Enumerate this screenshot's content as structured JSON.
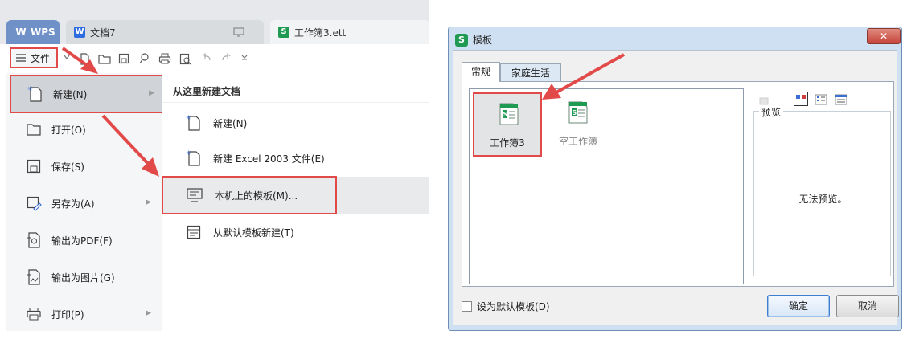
{
  "wps": {
    "tabs": [
      {
        "label": "WPS"
      },
      {
        "label": "文档7"
      },
      {
        "label": "工作簿3.ett"
      }
    ],
    "menu_button_label": "文件",
    "file_menu": [
      {
        "label": "新建(N)",
        "icon": "new-file-icon",
        "has_submenu": true
      },
      {
        "label": "打开(O)",
        "icon": "open-folder-icon",
        "has_submenu": false
      },
      {
        "label": "保存(S)",
        "icon": "save-icon",
        "has_submenu": false
      },
      {
        "label": "另存为(A)",
        "icon": "save-as-icon",
        "has_submenu": true
      },
      {
        "label": "输出为PDF(F)",
        "icon": "export-pdf-icon",
        "has_submenu": false
      },
      {
        "label": "输出为图片(G)",
        "icon": "export-image-icon",
        "has_submenu": false
      },
      {
        "label": "打印(P)",
        "icon": "print-icon",
        "has_submenu": true
      }
    ],
    "submenu": {
      "title": "从这里新建文档",
      "items": [
        {
          "label": "新建(N)",
          "icon": "new-file-icon"
        },
        {
          "label": "新建 Excel 2003 文件(E)",
          "icon": "new-file-icon"
        },
        {
          "label": "本机上的模板(M)...",
          "icon": "local-template-icon"
        },
        {
          "label": "从默认模板新建(T)",
          "icon": "default-template-icon"
        }
      ]
    },
    "highlight_color": "#e24a4a"
  },
  "dialog": {
    "title": "模板",
    "close_label": "✕",
    "tabs": [
      {
        "label": "常规"
      },
      {
        "label": "家庭生活"
      }
    ],
    "templates": [
      {
        "label": "工作簿3"
      },
      {
        "label": "空工作簿"
      }
    ],
    "preview_label": "预览",
    "preview_empty": "无法预览。",
    "default_checkbox_label": "设为默认模板(D)",
    "ok_label": "确定",
    "cancel_label": "取消"
  }
}
